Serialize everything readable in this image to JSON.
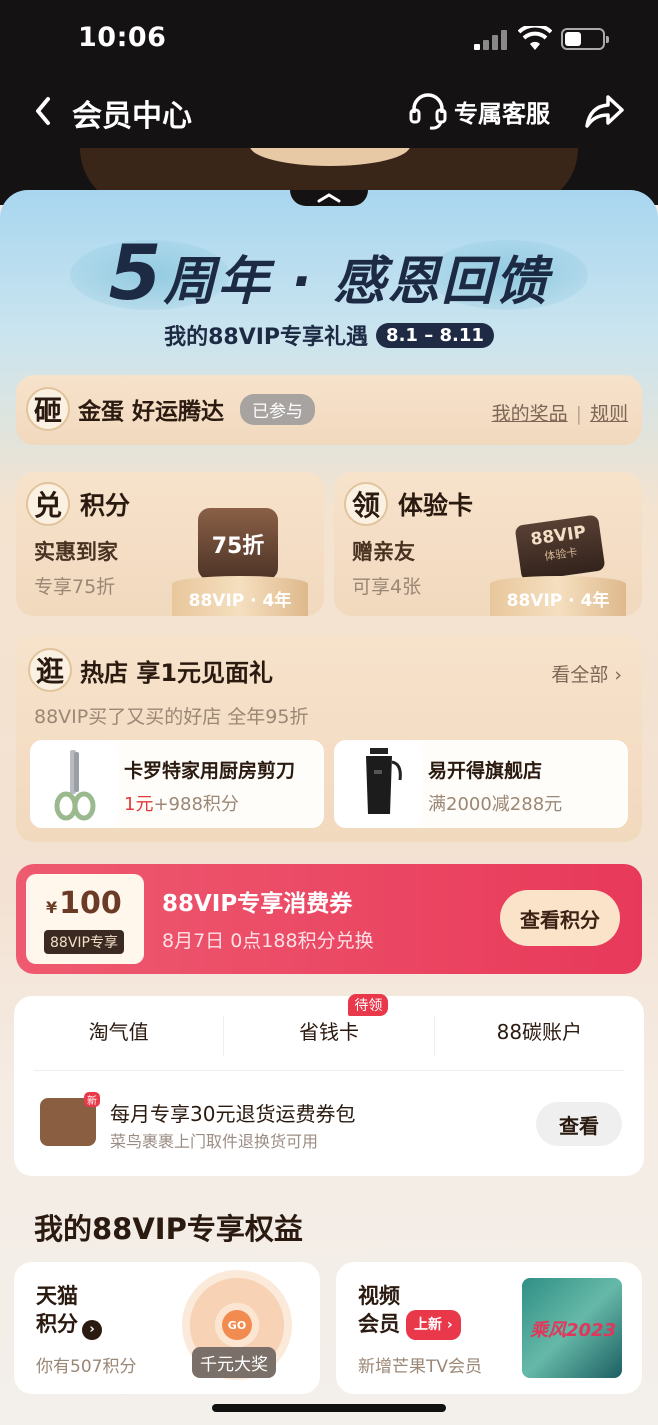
{
  "status": {
    "time": "10:06"
  },
  "nav": {
    "title": "会员中心",
    "service_label": "专属客服"
  },
  "hero": {
    "number": "5",
    "title": "周年 · 感恩回馈",
    "subtitle": "我的88VIP专享礼遇",
    "date_range": "8.1 – 8.11"
  },
  "egg": {
    "badge": "砸",
    "title": "金蛋 好运腾达",
    "status": "已参与",
    "link_prizes": "我的奖品",
    "link_rules": "规则"
  },
  "points_card": {
    "badge": "兑",
    "title": "积分",
    "line2": "实惠到家",
    "line3": "专享75折",
    "bag_text": "75折",
    "podium": "88VIP · 4年"
  },
  "trial_card": {
    "badge": "领",
    "title": "体验卡",
    "line2": "赠亲友",
    "line3": "可享4张",
    "card_title": "88VIP",
    "card_sub": "体验卡",
    "podium": "88VIP · 4年"
  },
  "shops": {
    "badge": "逛",
    "title": "热店 享1元见面礼",
    "see_all": "看全部 ›",
    "desc": "88VIP买了又买的好店 全年95折",
    "items": [
      {
        "name": "卡罗特家用厨房剪刀",
        "price_red": "1元",
        "price_rest": "+988积分"
      },
      {
        "name": "易开得旗舰店",
        "price_red": "",
        "price_rest": "满2000减288元"
      }
    ]
  },
  "coupon": {
    "currency": "¥",
    "amount": "100",
    "tag": "88VIP专享",
    "title": "88VIP专享消费券",
    "desc": "8月7日 0点188积分兑换",
    "button": "查看积分"
  },
  "tabs": {
    "items": [
      "淘气值",
      "省钱卡",
      "88碳账户"
    ],
    "badge": "待领"
  },
  "return": {
    "icon_tag": "新",
    "title": "每月专享30元退货运费券包",
    "desc": "菜鸟裹裹上门取件退换货可用",
    "button": "查看"
  },
  "benefits": {
    "title": "我的88VIP专享权益",
    "tmall": {
      "line1": "天猫",
      "line2": "积分",
      "desc": "你有507积分",
      "wheel_go": "GO",
      "wheel_label": "千元大奖"
    },
    "video": {
      "line1": "视频",
      "line2": "会员",
      "tag": "上新",
      "desc": "新增芒果TV会员",
      "poster": "乘风2023"
    }
  },
  "colors": {
    "accent_red": "#e8395a",
    "dark": "#141212",
    "navy": "#1d2a44"
  }
}
